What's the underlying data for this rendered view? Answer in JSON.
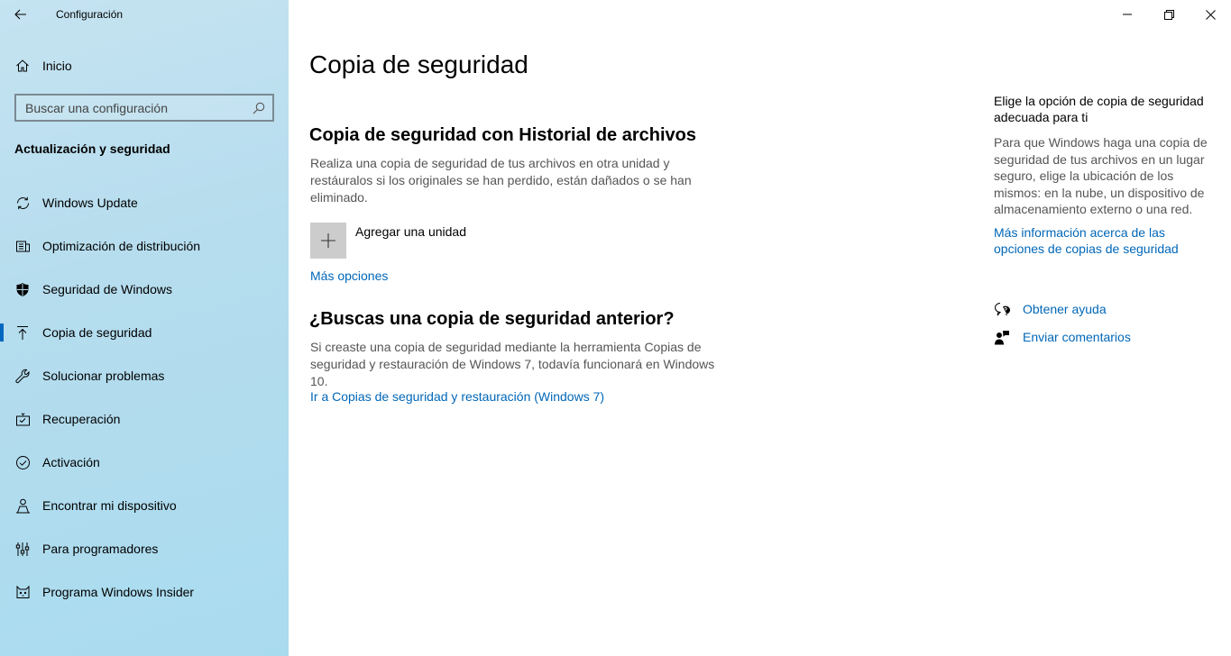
{
  "window": {
    "title": "Configuración"
  },
  "sidebar": {
    "home_label": "Inicio",
    "search_placeholder": "Buscar una configuración",
    "section_heading": "Actualización y seguridad",
    "items": [
      {
        "label": "Windows Update",
        "icon": "refresh-icon"
      },
      {
        "label": "Optimización de distribución",
        "icon": "delivery-optimization-icon"
      },
      {
        "label": "Seguridad de Windows",
        "icon": "shield-icon"
      },
      {
        "label": "Copia de seguridad",
        "icon": "backup-arrow-up-icon",
        "active": true
      },
      {
        "label": "Solucionar problemas",
        "icon": "wrench-icon"
      },
      {
        "label": "Recuperación",
        "icon": "recovery-icon"
      },
      {
        "label": "Activación",
        "icon": "check-circle-icon"
      },
      {
        "label": "Encontrar mi dispositivo",
        "icon": "person-pin-icon"
      },
      {
        "label": "Para programadores",
        "icon": "developer-sliders-icon"
      },
      {
        "label": "Programa Windows Insider",
        "icon": "insider-cat-icon"
      }
    ]
  },
  "main": {
    "page_title": "Copia de seguridad",
    "file_history": {
      "heading": "Copia de seguridad con Historial de archivos",
      "description": "Realiza una copia de seguridad de tus archivos en otra unidad y restáuralos si los originales se han perdido, están dañados o se han eliminado.",
      "add_drive_label": "Agregar una unidad",
      "more_options_link": "Más opciones"
    },
    "older_backup": {
      "heading": "¿Buscas una copia de seguridad anterior?",
      "description": "Si creaste una copia de seguridad mediante la herramienta Copias de seguridad y restauración de Windows 7, todavía funcionará en Windows 10.",
      "link": "Ir a Copias de seguridad y restauración (Windows 7)"
    }
  },
  "right_panel": {
    "heading": "Elige la opción de copia de seguridad adecuada para ti",
    "description": "Para que Windows haga una copia de seguridad de tus archivos en un lugar seguro, elige la ubicación de los mismos: en la nube, un dispositivo de almacenamiento externo o una red.",
    "more_info_link": "Más información acerca de las opciones de copias de seguridad",
    "help_label": "Obtener ayuda",
    "feedback_label": "Enviar comentarios"
  },
  "colors": {
    "accent": "#0067b8",
    "sidebar_bg": "#b6ddee",
    "active_indicator": "#0067c0"
  }
}
